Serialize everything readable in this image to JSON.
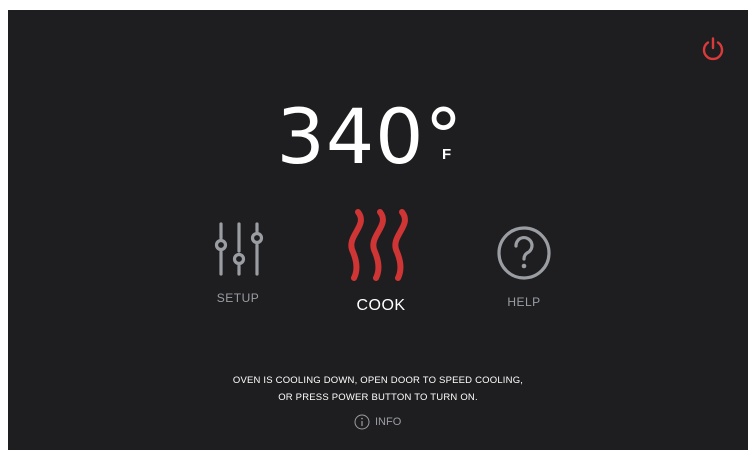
{
  "temperature": {
    "value": "340°",
    "unit": "F"
  },
  "modes": {
    "setup_label": "SETUP",
    "cook_label": "COOK",
    "help_label": "HELP"
  },
  "message": {
    "line1": "OVEN IS COOLING DOWN, OPEN DOOR TO SPEED COOLING,",
    "line2": "OR PRESS POWER BUTTON TO TURN ON."
  },
  "info_label": "INFO",
  "icons": {
    "power": "power-icon",
    "setup": "sliders-icon",
    "cook": "heat-waves-icon",
    "help": "question-circle-icon",
    "info": "info-icon"
  },
  "colors": {
    "background": "#1e1e20",
    "power": "#d93a3a",
    "cook": "#cf3535",
    "muted": "#9a9ea3",
    "text": "#ffffff"
  }
}
